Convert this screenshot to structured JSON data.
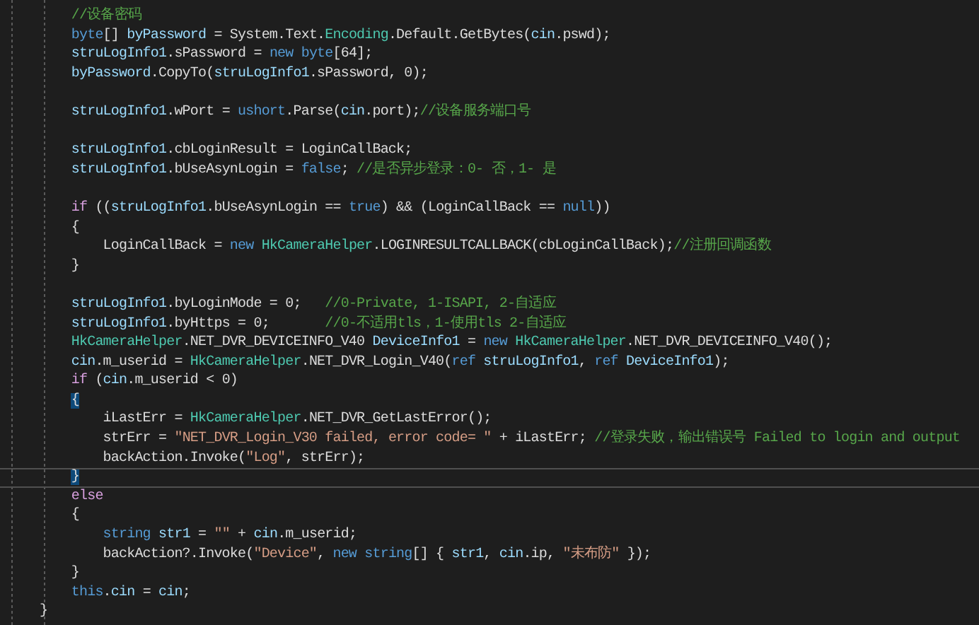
{
  "editor": {
    "lines": [
      {
        "kind": "group",
        "children": [
          {
            "kind": "code",
            "tokens": [
              {
                "kind": "comment",
                "text": "//设备密码"
              }
            ]
          },
          {
            "kind": "code",
            "tokens": [
              {
                "kind": "keyword",
                "text": "byte"
              },
              {
                "kind": "plain",
                "text": "[] "
              },
              {
                "kind": "variable",
                "text": "byPassword"
              },
              {
                "kind": "plain",
                "text": " = System.Text."
              },
              {
                "kind": "type",
                "text": "Encoding"
              },
              {
                "kind": "plain",
                "text": ".Default.GetBytes("
              },
              {
                "kind": "variable",
                "text": "cin"
              },
              {
                "kind": "plain",
                "text": ".pswd);"
              }
            ]
          },
          {
            "kind": "code",
            "tokens": [
              {
                "kind": "variable",
                "text": "struLogInfo1"
              },
              {
                "kind": "plain",
                "text": ".sPassword = "
              },
              {
                "kind": "keyword",
                "text": "new "
              },
              {
                "kind": "keyword",
                "text": "byte"
              },
              {
                "kind": "plain",
                "text": "[64];"
              }
            ]
          },
          {
            "kind": "code",
            "tokens": [
              {
                "kind": "variable",
                "text": "byPassword"
              },
              {
                "kind": "plain",
                "text": ".CopyTo("
              },
              {
                "kind": "variable",
                "text": "struLogInfo1"
              },
              {
                "kind": "plain",
                "text": ".sPassword, 0);"
              }
            ]
          },
          {
            "kind": "blank"
          },
          {
            "kind": "code",
            "tokens": [
              {
                "kind": "variable",
                "text": "struLogInfo1"
              },
              {
                "kind": "plain",
                "text": ".wPort = "
              },
              {
                "kind": "keyword",
                "text": "ushort"
              },
              {
                "kind": "plain",
                "text": ".Parse("
              },
              {
                "kind": "variable",
                "text": "cin"
              },
              {
                "kind": "plain",
                "text": ".port);"
              },
              {
                "kind": "comment",
                "text": "//设备服务端口号"
              }
            ]
          },
          {
            "kind": "blank"
          },
          {
            "kind": "code",
            "tokens": [
              {
                "kind": "variable",
                "text": "struLogInfo1"
              },
              {
                "kind": "plain",
                "text": ".cbLoginResult = LoginCallBack;"
              }
            ]
          },
          {
            "kind": "code",
            "tokens": [
              {
                "kind": "variable",
                "text": "struLogInfo1"
              },
              {
                "kind": "plain",
                "text": ".bUseAsynLogin = "
              },
              {
                "kind": "keyword",
                "text": "false"
              },
              {
                "kind": "plain",
                "text": "; "
              },
              {
                "kind": "comment",
                "text": "//是否异步登录：0- 否，1- 是"
              }
            ]
          },
          {
            "kind": "blank"
          },
          {
            "kind": "code",
            "tokens": [
              {
                "kind": "control",
                "text": "if"
              },
              {
                "kind": "plain",
                "text": " (("
              },
              {
                "kind": "variable",
                "text": "struLogInfo1"
              },
              {
                "kind": "plain",
                "text": ".bUseAsynLogin == "
              },
              {
                "kind": "keyword",
                "text": "true"
              },
              {
                "kind": "plain",
                "text": ") && (LoginCallBack == "
              },
              {
                "kind": "keyword",
                "text": "null"
              },
              {
                "kind": "plain",
                "text": "))"
              }
            ]
          },
          {
            "kind": "code",
            "tokens": [
              {
                "kind": "plain",
                "text": "{"
              }
            ],
            "children": [
              {
                "kind": "code",
                "tokens": [
                  {
                    "kind": "plain",
                    "text": "LoginCallBack = "
                  },
                  {
                    "kind": "keyword",
                    "text": "new "
                  },
                  {
                    "kind": "type",
                    "text": "HkCameraHelper"
                  },
                  {
                    "kind": "plain",
                    "text": ".LOGINRESULTCALLBACK(cbLoginCallBack);"
                  },
                  {
                    "kind": "comment",
                    "text": "//注册回调函数"
                  }
                ]
              }
            ]
          },
          {
            "kind": "code",
            "tokens": [
              {
                "kind": "plain",
                "text": "}"
              }
            ]
          },
          {
            "kind": "blank"
          },
          {
            "kind": "code",
            "tokens": [
              {
                "kind": "variable",
                "text": "struLogInfo1"
              },
              {
                "kind": "plain",
                "text": ".byLoginMode = 0;   "
              },
              {
                "kind": "comment",
                "text": "//0-Private, 1-ISAPI, 2-自适应"
              }
            ]
          },
          {
            "kind": "code",
            "tokens": [
              {
                "kind": "variable",
                "text": "struLogInfo1"
              },
              {
                "kind": "plain",
                "text": ".byHttps = 0;       "
              },
              {
                "kind": "comment",
                "text": "//0-不适用tls，1-使用tls 2-自适应"
              }
            ]
          },
          {
            "kind": "code",
            "tokens": [
              {
                "kind": "type",
                "text": "HkCameraHelper"
              },
              {
                "kind": "plain",
                "text": ".NET_DVR_DEVICEINFO_V40 "
              },
              {
                "kind": "variable",
                "text": "DeviceInfo1"
              },
              {
                "kind": "plain",
                "text": " = "
              },
              {
                "kind": "keyword",
                "text": "new "
              },
              {
                "kind": "type",
                "text": "HkCameraHelper"
              },
              {
                "kind": "plain",
                "text": ".NET_DVR_DEVICEINFO_V40();"
              }
            ]
          },
          {
            "kind": "code",
            "tokens": [
              {
                "kind": "variable",
                "text": "cin"
              },
              {
                "kind": "plain",
                "text": ".m_userid = "
              },
              {
                "kind": "type",
                "text": "HkCameraHelper"
              },
              {
                "kind": "plain",
                "text": ".NET_DVR_Login_V40("
              },
              {
                "kind": "keyword",
                "text": "ref "
              },
              {
                "kind": "variable",
                "text": "struLogInfo1"
              },
              {
                "kind": "plain",
                "text": ", "
              },
              {
                "kind": "keyword",
                "text": "ref "
              },
              {
                "kind": "variable",
                "text": "DeviceInfo1"
              },
              {
                "kind": "plain",
                "text": ");"
              }
            ]
          },
          {
            "kind": "code",
            "tokens": [
              {
                "kind": "control",
                "text": "if"
              },
              {
                "kind": "plain",
                "text": " ("
              },
              {
                "kind": "variable",
                "text": "cin"
              },
              {
                "kind": "plain",
                "text": ".m_userid < 0)"
              }
            ]
          },
          {
            "kind": "code",
            "tokens": [
              {
                "kind": "brace",
                "text": "{"
              }
            ],
            "children": [
              {
                "kind": "code",
                "tokens": [
                  {
                    "kind": "plain",
                    "text": "iLastErr = "
                  },
                  {
                    "kind": "type",
                    "text": "HkCameraHelper"
                  },
                  {
                    "kind": "plain",
                    "text": ".NET_DVR_GetLastError();"
                  }
                ]
              },
              {
                "kind": "code",
                "tokens": [
                  {
                    "kind": "plain",
                    "text": "strErr = "
                  },
                  {
                    "kind": "string",
                    "text": "\"NET_DVR_Login_V30 failed, error code= \""
                  },
                  {
                    "kind": "plain",
                    "text": " + iLastErr; "
                  },
                  {
                    "kind": "comment",
                    "text": "//登录失败，输出错误号 Failed to login and output"
                  }
                ]
              },
              {
                "kind": "code",
                "tokens": [
                  {
                    "kind": "plain",
                    "text": "backAction.Invoke("
                  },
                  {
                    "kind": "string",
                    "text": "\"Log\""
                  },
                  {
                    "kind": "plain",
                    "text": ", strErr);"
                  }
                ]
              }
            ]
          },
          {
            "kind": "code",
            "current": true,
            "tokens": [
              {
                "kind": "brace",
                "text": "}"
              }
            ]
          },
          {
            "kind": "code",
            "tokens": [
              {
                "kind": "control",
                "text": "else"
              }
            ]
          },
          {
            "kind": "code",
            "tokens": [
              {
                "kind": "plain",
                "text": "{"
              }
            ],
            "children": [
              {
                "kind": "code",
                "tokens": [
                  {
                    "kind": "keyword",
                    "text": "string "
                  },
                  {
                    "kind": "variable",
                    "text": "str1"
                  },
                  {
                    "kind": "plain",
                    "text": " = "
                  },
                  {
                    "kind": "string",
                    "text": "\"\""
                  },
                  {
                    "kind": "plain",
                    "text": " + "
                  },
                  {
                    "kind": "variable",
                    "text": "cin"
                  },
                  {
                    "kind": "plain",
                    "text": ".m_userid;"
                  }
                ]
              },
              {
                "kind": "code",
                "tokens": [
                  {
                    "kind": "plain",
                    "text": "backAction?.Invoke("
                  },
                  {
                    "kind": "string",
                    "text": "\"Device\""
                  },
                  {
                    "kind": "plain",
                    "text": ", "
                  },
                  {
                    "kind": "keyword",
                    "text": "new "
                  },
                  {
                    "kind": "keyword",
                    "text": "string"
                  },
                  {
                    "kind": "plain",
                    "text": "[] { "
                  },
                  {
                    "kind": "variable",
                    "text": "str1"
                  },
                  {
                    "kind": "plain",
                    "text": ", "
                  },
                  {
                    "kind": "variable",
                    "text": "cin"
                  },
                  {
                    "kind": "plain",
                    "text": ".ip, "
                  },
                  {
                    "kind": "string",
                    "text": "\"未布防\""
                  },
                  {
                    "kind": "plain",
                    "text": " });"
                  }
                ]
              }
            ]
          },
          {
            "kind": "code",
            "tokens": [
              {
                "kind": "plain",
                "text": "}"
              }
            ]
          },
          {
            "kind": "code",
            "tokens": [
              {
                "kind": "keyword",
                "text": "this"
              },
              {
                "kind": "plain",
                "text": "."
              },
              {
                "kind": "variable",
                "text": "cin"
              },
              {
                "kind": "plain",
                "text": " = "
              },
              {
                "kind": "variable",
                "text": "cin"
              },
              {
                "kind": "plain",
                "text": ";"
              }
            ]
          }
        ]
      },
      {
        "kind": "code",
        "tokens": [
          {
            "kind": "plain",
            "text": "}"
          }
        ]
      }
    ]
  }
}
